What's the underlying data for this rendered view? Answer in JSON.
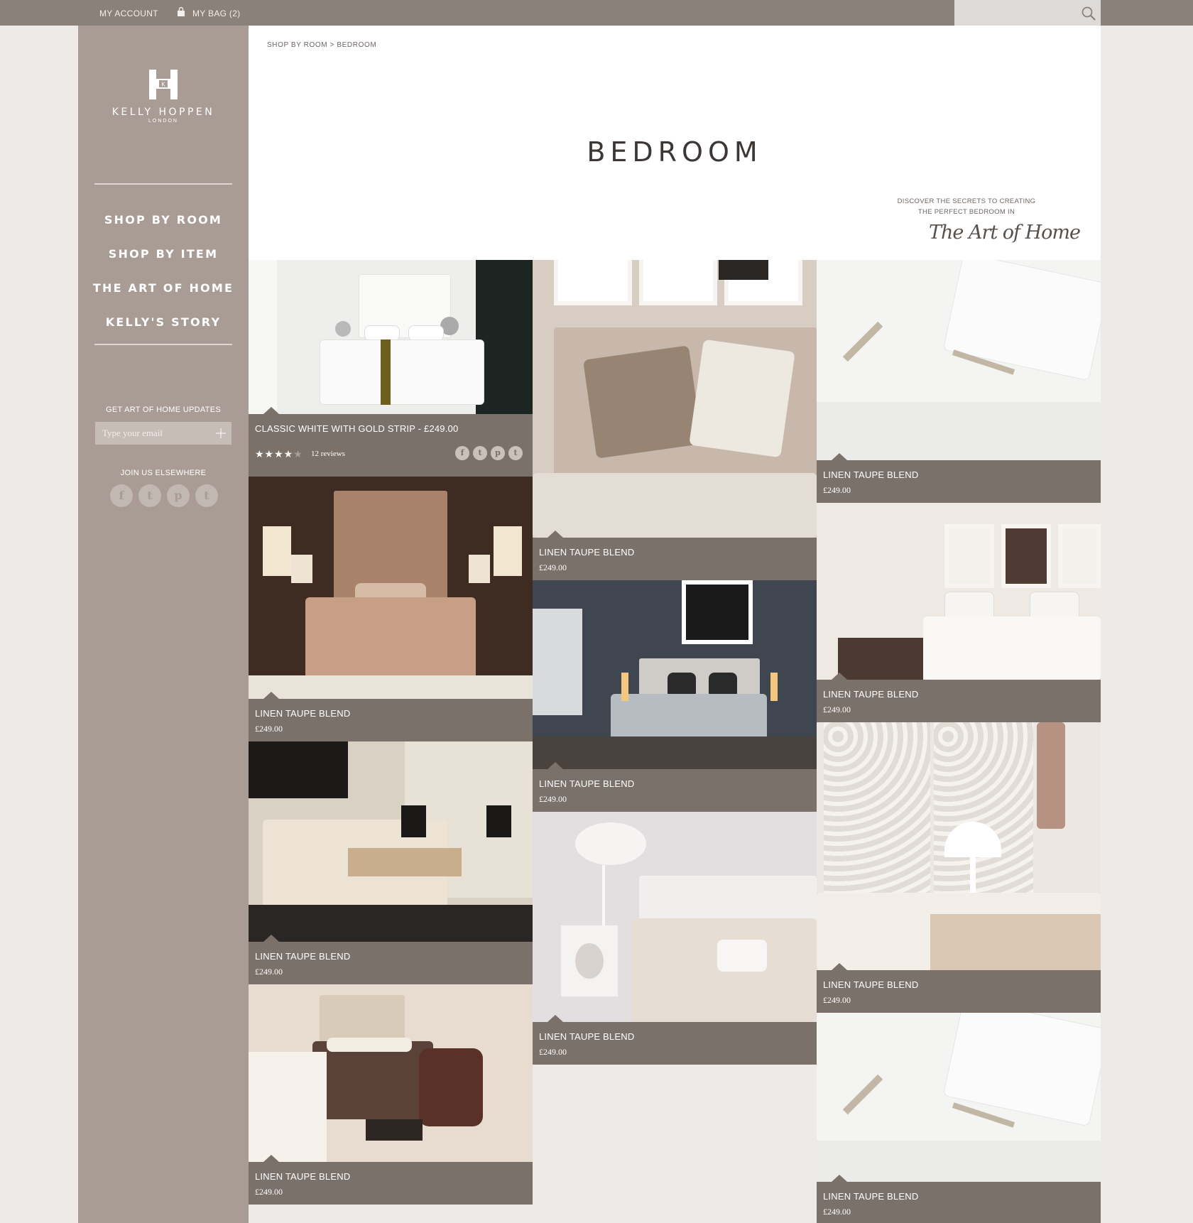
{
  "topbar": {
    "account_label": "MY ACCOUNT",
    "bag_label": "MY BAG (2)",
    "search_placeholder": ""
  },
  "brand": {
    "name": "KELLY HOPPEN",
    "city": "LONDON"
  },
  "nav": [
    "SHOP BY ROOM",
    "SHOP BY ITEM",
    "THE ART OF HOME",
    "KELLY'S STORY"
  ],
  "newsletter": {
    "heading": "GET ART OF HOME UPDATES",
    "placeholder": "Type your email"
  },
  "social": {
    "heading": "JOIN US ELSEWHERE",
    "icons": [
      "facebook-icon",
      "twitter-icon",
      "pinterest-icon",
      "tumblr-icon"
    ]
  },
  "breadcrumb": "SHOP BY ROOM  >  BEDROOM",
  "page_title": "BEDROOM",
  "promo": {
    "line1": "DISCOVER THE SECRETS TO CREATING",
    "line2": "THE PERFECT BEDROOM IN",
    "logo_text": "The Art of Home"
  },
  "featured": {
    "name": "CLASSIC WHITE WITH GOLD STRIP - £249.00",
    "rating": 4,
    "rating_max": 5,
    "reviews": "12 reviews"
  },
  "products": {
    "c1": [
      {
        "name": "LINEN TAUPE BLEND",
        "price": "£249.00"
      },
      {
        "name": "LINEN TAUPE BLEND",
        "price": "£249.00"
      },
      {
        "name": "LINEN TAUPE BLEND",
        "price": "£249.00"
      }
    ],
    "c2": [
      {
        "name": "LINEN TAUPE BLEND",
        "price": "£249.00"
      },
      {
        "name": "LINEN TAUPE BLEND",
        "price": "£249.00"
      },
      {
        "name": "LINEN TAUPE BLEND",
        "price": "£249.00"
      }
    ],
    "c3": [
      {
        "name": "LINEN TAUPE BLEND",
        "price": "£249.00"
      },
      {
        "name": "LINEN TAUPE BLEND",
        "price": "£249.00"
      },
      {
        "name": "LINEN TAUPE BLEND",
        "price": "£249.00"
      },
      {
        "name": "LINEN TAUPE BLEND",
        "price": "£249.00"
      }
    ]
  },
  "colors": {
    "topbar": "#8b817b",
    "sidebar": "#a89c94",
    "caption": "#7a716b",
    "page": "#edeae7"
  }
}
